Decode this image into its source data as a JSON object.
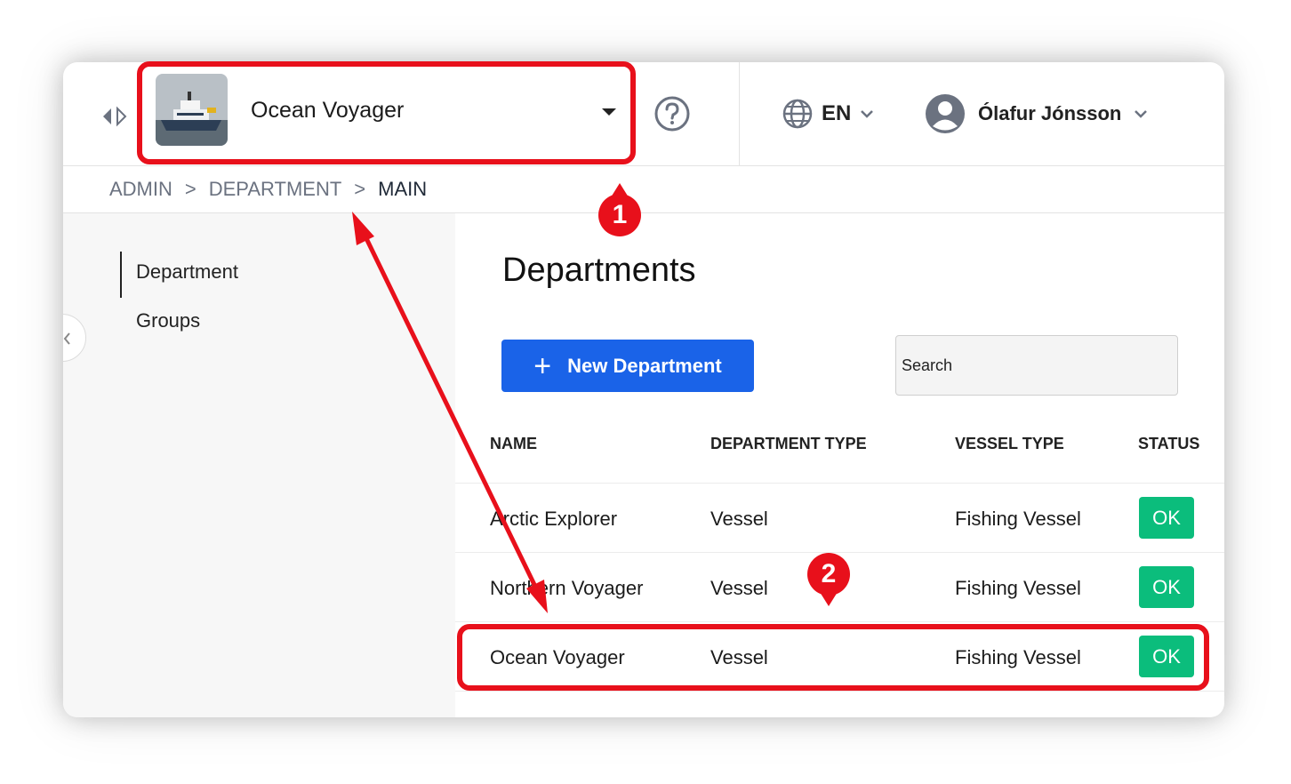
{
  "header": {
    "vessel_selector": {
      "selected": "Ocean Voyager"
    },
    "language": {
      "code": "EN"
    },
    "user": {
      "name": "Ólafur Jónsson"
    }
  },
  "breadcrumb": [
    {
      "label": "ADMIN"
    },
    {
      "label": "DEPARTMENT"
    },
    {
      "label": "MAIN"
    }
  ],
  "breadcrumb_separator": ">",
  "sidebar": {
    "items": [
      {
        "label": "Department",
        "active": true
      },
      {
        "label": "Groups",
        "active": false
      }
    ]
  },
  "main": {
    "title": "Departments",
    "new_button_icon": "+",
    "new_button_label": "New Department",
    "search_placeholder": "Search",
    "table": {
      "headers": [
        "NAME",
        "DEPARTMENT TYPE",
        "VESSEL TYPE",
        "STATUS"
      ],
      "rows": [
        {
          "name": "Arctic Explorer",
          "department_type": "Vessel",
          "vessel_type": "Fishing Vessel",
          "status": "OK"
        },
        {
          "name": "Northern Voyager",
          "department_type": "Vessel",
          "vessel_type": "Fishing Vessel",
          "status": "OK"
        },
        {
          "name": "Ocean Voyager",
          "department_type": "Vessel",
          "vessel_type": "Fishing Vessel",
          "status": "OK"
        }
      ]
    }
  },
  "annotations": {
    "marker_1": "1",
    "marker_2": "2"
  },
  "colors": {
    "primary_button": "#1a63e8",
    "status_ok": "#0bbd7c",
    "annotation_red": "#e8101b"
  },
  "icons": [
    "panel-toggle-icon",
    "vessel-thumbnail",
    "caret-down-icon",
    "help-icon",
    "globe-icon",
    "chevron-down-icon",
    "user-avatar-icon",
    "collapse-chevron-icon",
    "plus-icon"
  ]
}
